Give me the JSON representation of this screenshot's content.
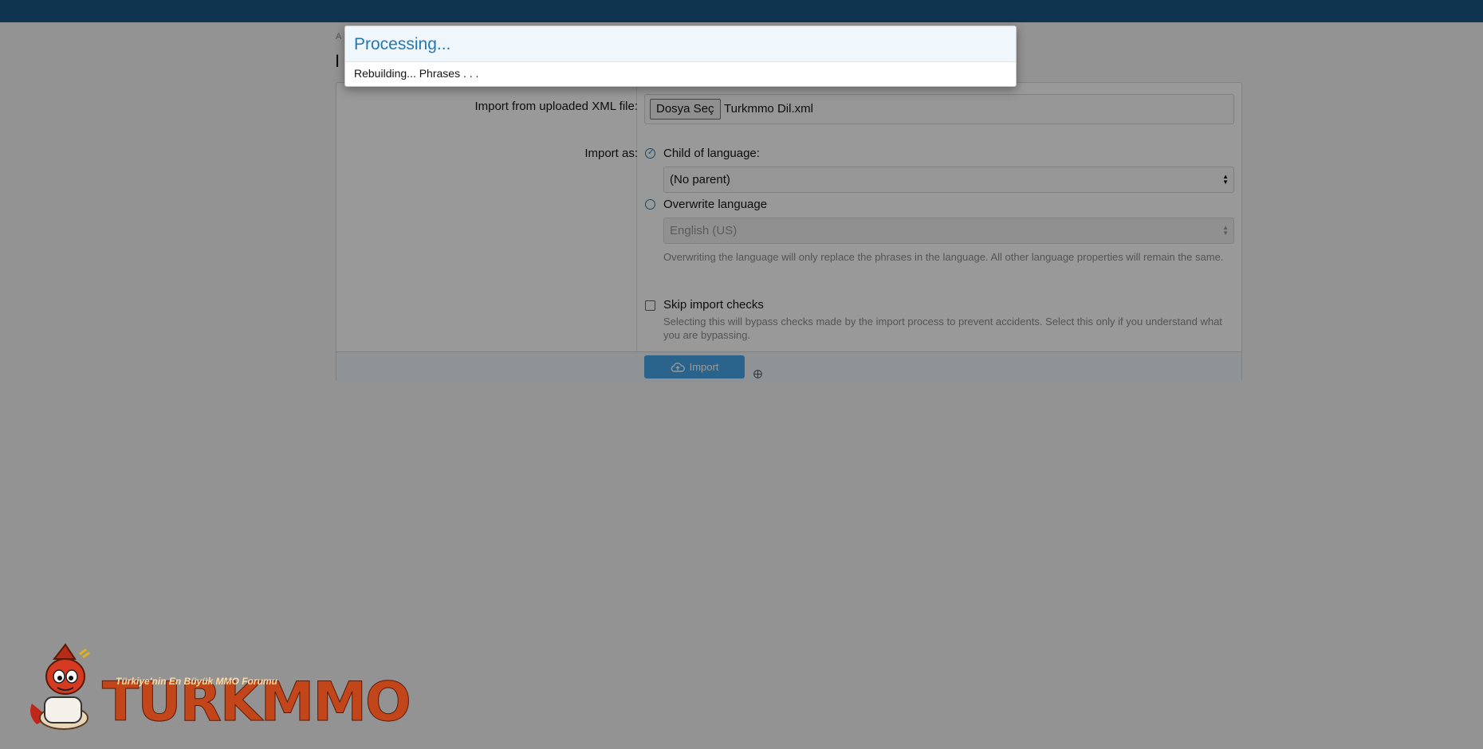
{
  "page": {
    "crumb_stub": "A",
    "title_stub": "I"
  },
  "form": {
    "file_label": "Import from uploaded XML file:",
    "file_button": "Dosya Seç",
    "file_name": "Turkmmo Dil.xml",
    "import_as_label": "Import as:",
    "option_child": "Child of language:",
    "parent_select": "(No parent)",
    "option_overwrite": "Overwrite language",
    "overwrite_select": "English (US)",
    "overwrite_hint": "Overwriting the language will only replace the phrases in the language. All other language properties will remain the same.",
    "skip_label": "Skip import checks",
    "skip_hint": "Selecting this will bypass checks made by the import process to prevent accidents. Select this only if you understand what you are bypassing.",
    "import_button": "Import"
  },
  "modal": {
    "title": "Processing...",
    "body": "Rebuilding... Phrases . . ."
  },
  "logo": {
    "tagline": "Türkiye'nin En Büyük MMO Forumu",
    "wordmark": "TURKMMO"
  },
  "colors": {
    "topbar": "#185886",
    "accent": "#2577b1",
    "button": "#47a7eb"
  }
}
